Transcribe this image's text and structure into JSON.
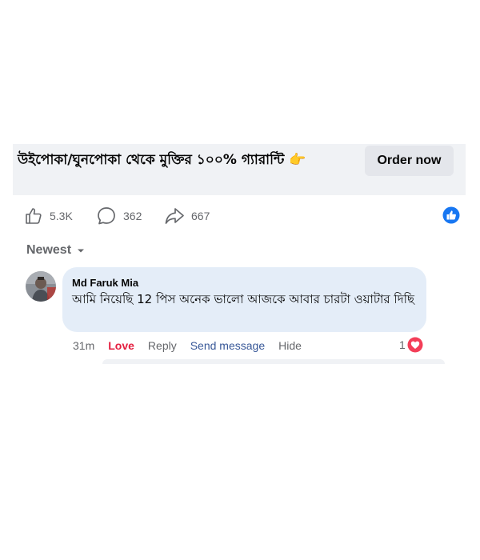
{
  "ad": {
    "headline": "উইপোকা/ঘুনপোকা থেকে মুক্তির ১০০% গ্যারান্টি 👉",
    "cta_label": "Order now"
  },
  "post_stats": {
    "likes": "5.3K",
    "comments": "362",
    "shares": "667"
  },
  "comments_sort": {
    "label": "Newest"
  },
  "comment": {
    "author": "Md Faruk Mia",
    "text": "আমি নিয়েছি 12 পিস অনেক ভালো আজকে আবার চারটা ওয়াটার দিছি",
    "time": "31m",
    "reaction_label": "Love",
    "reply_label": "Reply",
    "send_message_label": "Send message",
    "hide_label": "Hide",
    "reaction_count": "1"
  },
  "colors": {
    "love": "#e41e3f",
    "link": "#385898",
    "like_blue": "#1877f2",
    "bubble": "#e4edf8"
  }
}
